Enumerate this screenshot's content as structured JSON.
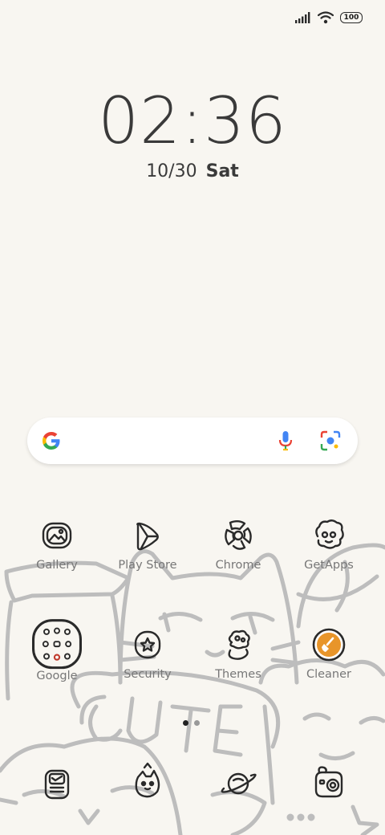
{
  "status_bar": {
    "signal_icon": "cellular-signal-icon",
    "wifi_icon": "wifi-icon",
    "battery_level": "100"
  },
  "clock": {
    "time": "02:36",
    "date": "10/30",
    "day": "Sat"
  },
  "search_bar": {
    "google_icon": "google-g-logo",
    "mic_icon": "microphone-icon",
    "lens_icon": "google-lens-icon"
  },
  "apps": [
    {
      "label": "Gallery",
      "icon": "gallery-icon"
    },
    {
      "label": "Play Store",
      "icon": "play-store-icon"
    },
    {
      "label": "Chrome",
      "icon": "chrome-icon"
    },
    {
      "label": "GetApps",
      "icon": "getapps-icon"
    },
    {
      "label": "Google",
      "icon": "google-folder-icon"
    },
    {
      "label": "Security",
      "icon": "security-icon"
    },
    {
      "label": "Themes",
      "icon": "themes-icon"
    },
    {
      "label": "Cleaner",
      "icon": "cleaner-icon"
    }
  ],
  "dock": [
    {
      "icon": "phone-dialer-icon"
    },
    {
      "icon": "messaging-icon"
    },
    {
      "icon": "browser-icon"
    },
    {
      "icon": "camera-icon"
    }
  ],
  "page_indicator": {
    "pages": 2,
    "current": 1
  },
  "wallpaper": {
    "text": "CUTE"
  },
  "colors": {
    "background": "#f8f6f1",
    "accent_cleaner": "#e8952a",
    "google_blue": "#4285F4",
    "google_red": "#EA4335",
    "google_yellow": "#FBBC05",
    "google_green": "#34A853"
  }
}
